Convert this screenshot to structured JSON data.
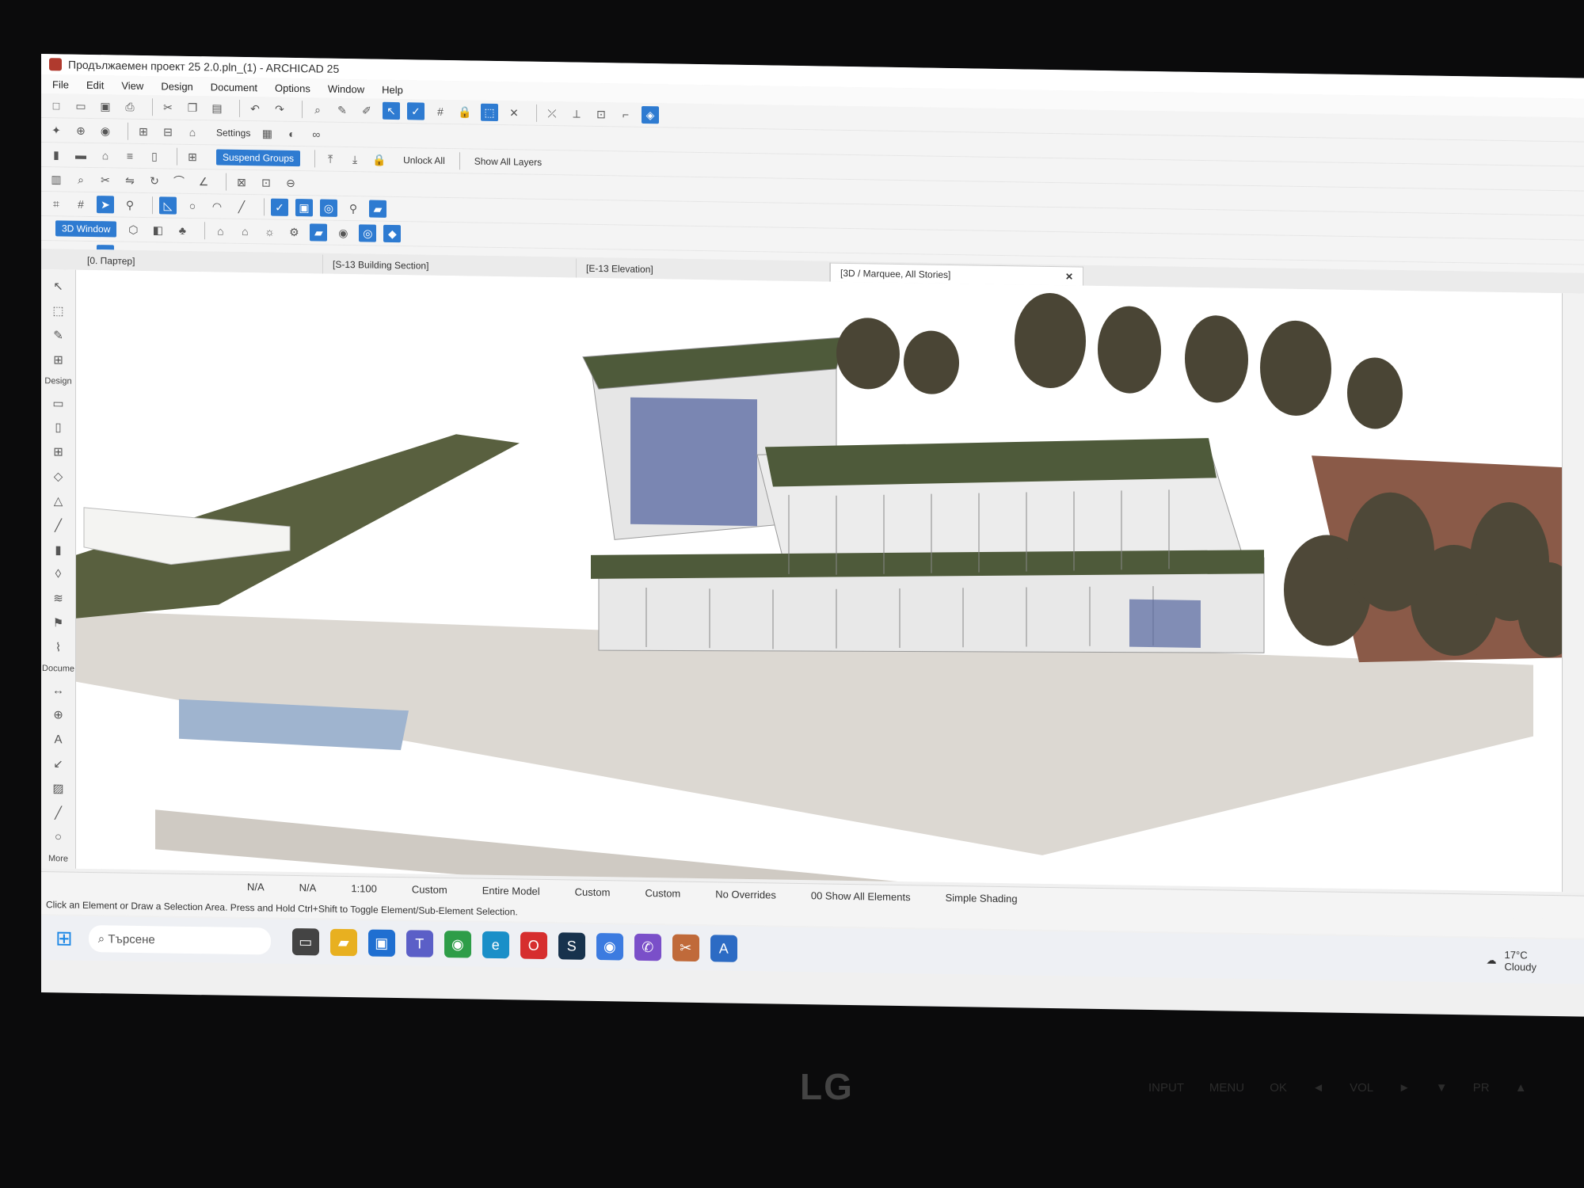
{
  "window": {
    "title": "Продължаемен проект 25 2.0.pln_(1) - ARCHICAD 25"
  },
  "menu": [
    "File",
    "Edit",
    "View",
    "Design",
    "Document",
    "Options",
    "Window",
    "Help"
  ],
  "toolbar": {
    "settings_label": "Settings",
    "suspend_groups_label": "Suspend Groups",
    "unlock_all_label": "Unlock All",
    "show_all_layers_label": "Show All Layers",
    "window_3d_label": "3D Window"
  },
  "tabs": [
    {
      "label": "[0. Партер]"
    },
    {
      "label": "[S-13 Building Section]"
    },
    {
      "label": "[E-13 Elevation]"
    },
    {
      "label": "[3D / Marquee, All Stories]",
      "active": true
    }
  ],
  "toolbox": {
    "design_label": "Design",
    "document_label": "Docume",
    "more_label": "More"
  },
  "statusbar": {
    "na1": "N/A",
    "na2": "N/A",
    "scale": "1:100",
    "layer_combo": "Custom",
    "model_filter": "Entire Model",
    "pen_set": "Custom",
    "dimension": "Custom",
    "overrides": "No Overrides",
    "renovation": "00 Show All Elements",
    "shading": "Simple Shading"
  },
  "hint": "Click an Element or Draw a Selection Area. Press and Hold Ctrl+Shift to Toggle Element/Sub-Element Selection.",
  "taskbar": {
    "search_placeholder": "Търсене"
  },
  "weather": {
    "temp": "17°C",
    "condition": "Cloudy"
  },
  "bezel": {
    "brand": "LG",
    "controls": "INPUT MENU OK ◄ VOL ► ▼ PR ▲"
  },
  "colors": {
    "accent": "#2e7bd1",
    "roof": "#4e5a3a",
    "ground": "#8a5a48"
  }
}
